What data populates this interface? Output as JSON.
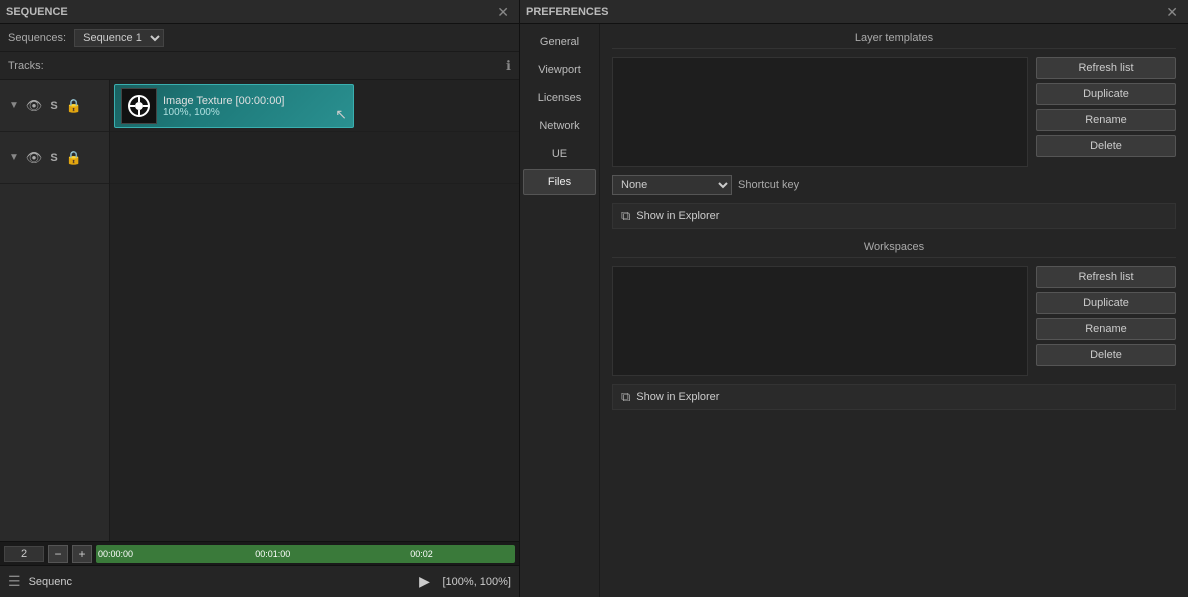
{
  "sequence_panel": {
    "title": "SEQUENCE",
    "sequences_label": "Sequences:",
    "sequence_name": "Sequence 1",
    "tracks_label": "Tracks:",
    "clip": {
      "name": "Image Texture [00:00:00]",
      "meta": "100%, 100%"
    },
    "frame_count": "2",
    "time_markers": [
      "00:00:00",
      "00:01:00",
      "00:02"
    ],
    "bottom_seq_name": "Sequenc",
    "zoom_label": "[100%, 100%]"
  },
  "preferences_panel": {
    "title": "PREFERENCES",
    "nav_items": [
      {
        "label": "General",
        "active": false
      },
      {
        "label": "Viewport",
        "active": false
      },
      {
        "label": "Licenses",
        "active": false
      },
      {
        "label": "Network",
        "active": false
      },
      {
        "label": "UE",
        "active": false
      },
      {
        "label": "Files",
        "active": true
      }
    ],
    "layer_templates": {
      "section_title": "Layer templates",
      "buttons": [
        "Refresh list",
        "Duplicate",
        "Rename",
        "Delete"
      ],
      "dropdown_value": "None",
      "shortcut_label": "Shortcut key",
      "explorer_label": "Show in Explorer"
    },
    "workspaces": {
      "section_title": "Workspaces",
      "buttons": [
        "Refresh list",
        "Duplicate",
        "Rename",
        "Delete"
      ],
      "explorer_label": "Show in Explorer"
    }
  }
}
